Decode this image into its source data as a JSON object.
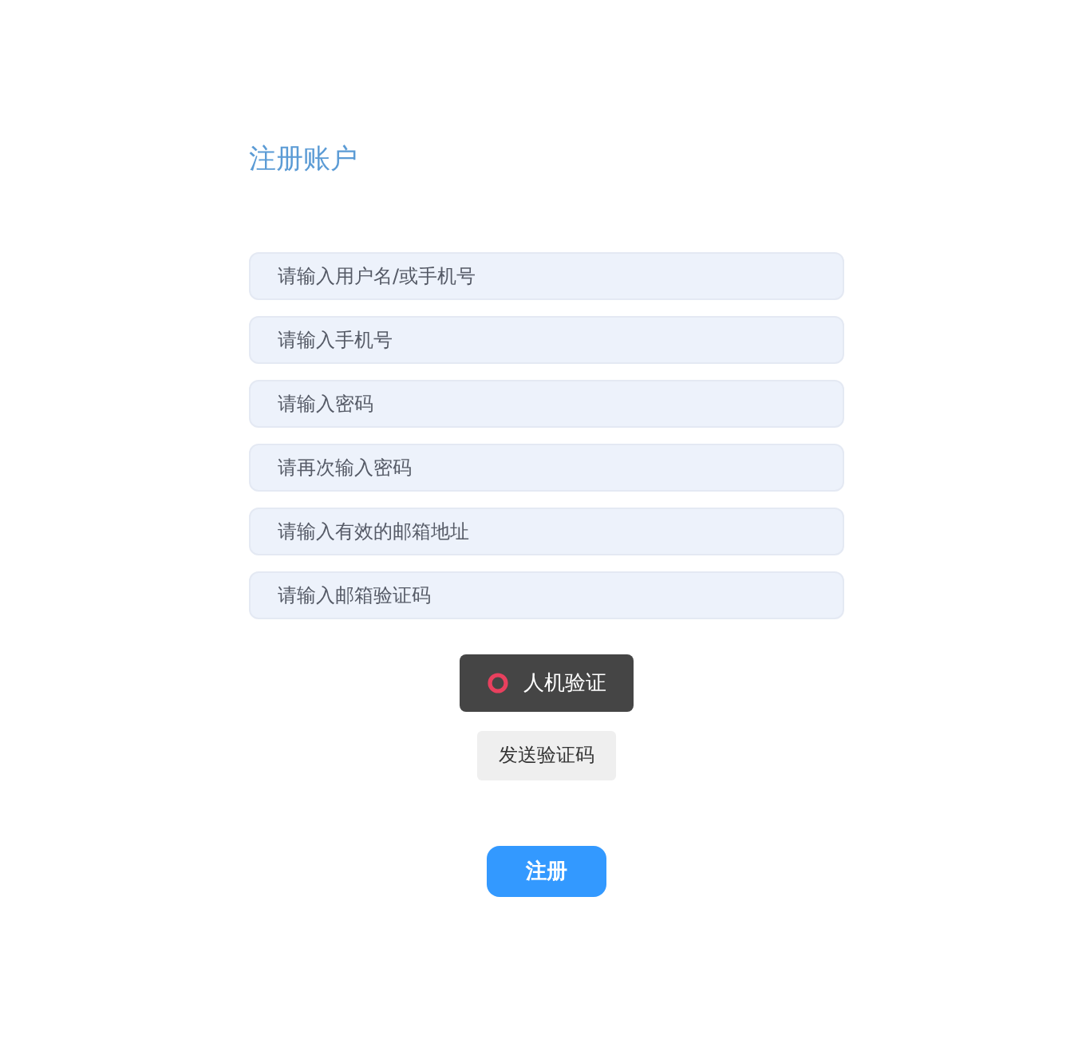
{
  "title": "注册账户",
  "fields": [
    {
      "placeholder": "请输入用户名/或手机号"
    },
    {
      "placeholder": "请输入手机号"
    },
    {
      "placeholder": "请输入密码"
    },
    {
      "placeholder": "请再次输入密码"
    },
    {
      "placeholder": "请输入有效的邮箱地址"
    },
    {
      "placeholder": "请输入邮箱验证码"
    }
  ],
  "captcha": {
    "label": "人机验证"
  },
  "send_code": "发送验证码",
  "submit": "注册"
}
